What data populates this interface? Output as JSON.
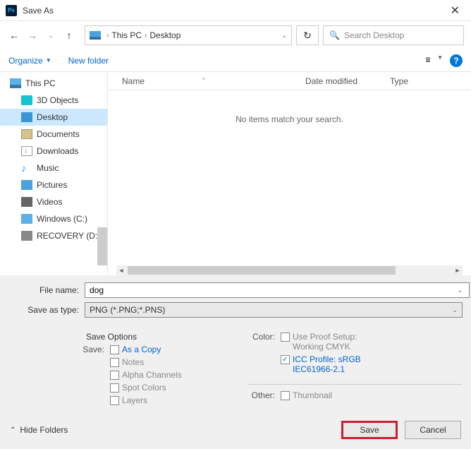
{
  "window": {
    "title": "Save As",
    "app_icon_text": "Ps"
  },
  "nav": {
    "path": [
      "This PC",
      "Desktop"
    ],
    "search_placeholder": "Search Desktop"
  },
  "toolbar": {
    "organize": "Organize",
    "new_folder": "New folder"
  },
  "sidebar": {
    "items": [
      {
        "label": "This PC",
        "icon": "icon-pc",
        "child": false,
        "selected": false
      },
      {
        "label": "3D Objects",
        "icon": "icon-3d",
        "child": true,
        "selected": false
      },
      {
        "label": "Desktop",
        "icon": "icon-desktop",
        "child": true,
        "selected": true
      },
      {
        "label": "Documents",
        "icon": "icon-doc",
        "child": true,
        "selected": false
      },
      {
        "label": "Downloads",
        "icon": "icon-dl",
        "child": true,
        "selected": false
      },
      {
        "label": "Music",
        "icon": "icon-music",
        "child": true,
        "selected": false
      },
      {
        "label": "Pictures",
        "icon": "icon-pic",
        "child": true,
        "selected": false
      },
      {
        "label": "Videos",
        "icon": "icon-vid",
        "child": true,
        "selected": false
      },
      {
        "label": "Windows (C:)",
        "icon": "icon-win",
        "child": true,
        "selected": false
      },
      {
        "label": "RECOVERY (D:)",
        "icon": "icon-rec",
        "child": true,
        "selected": false
      }
    ]
  },
  "columns": {
    "name": "Name",
    "date": "Date modified",
    "type": "Type"
  },
  "empty_message": "No items match your search.",
  "form": {
    "filename_label": "File name:",
    "filename_value": "dog",
    "savetype_label": "Save as type:",
    "savetype_value": "PNG (*.PNG;*.PNS)"
  },
  "options": {
    "title": "Save Options",
    "save_label": "Save:",
    "as_copy": "As a Copy",
    "notes": "Notes",
    "alpha": "Alpha Channels",
    "spot": "Spot Colors",
    "layers": "Layers",
    "color_label": "Color:",
    "proof1": "Use Proof Setup:",
    "proof2": "Working CMYK",
    "icc1": "ICC Profile:  sRGB",
    "icc2": "IEC61966-2.1",
    "other_label": "Other:",
    "thumbnail": "Thumbnail"
  },
  "footer": {
    "hide_folders": "Hide Folders",
    "save": "Save",
    "cancel": "Cancel"
  }
}
